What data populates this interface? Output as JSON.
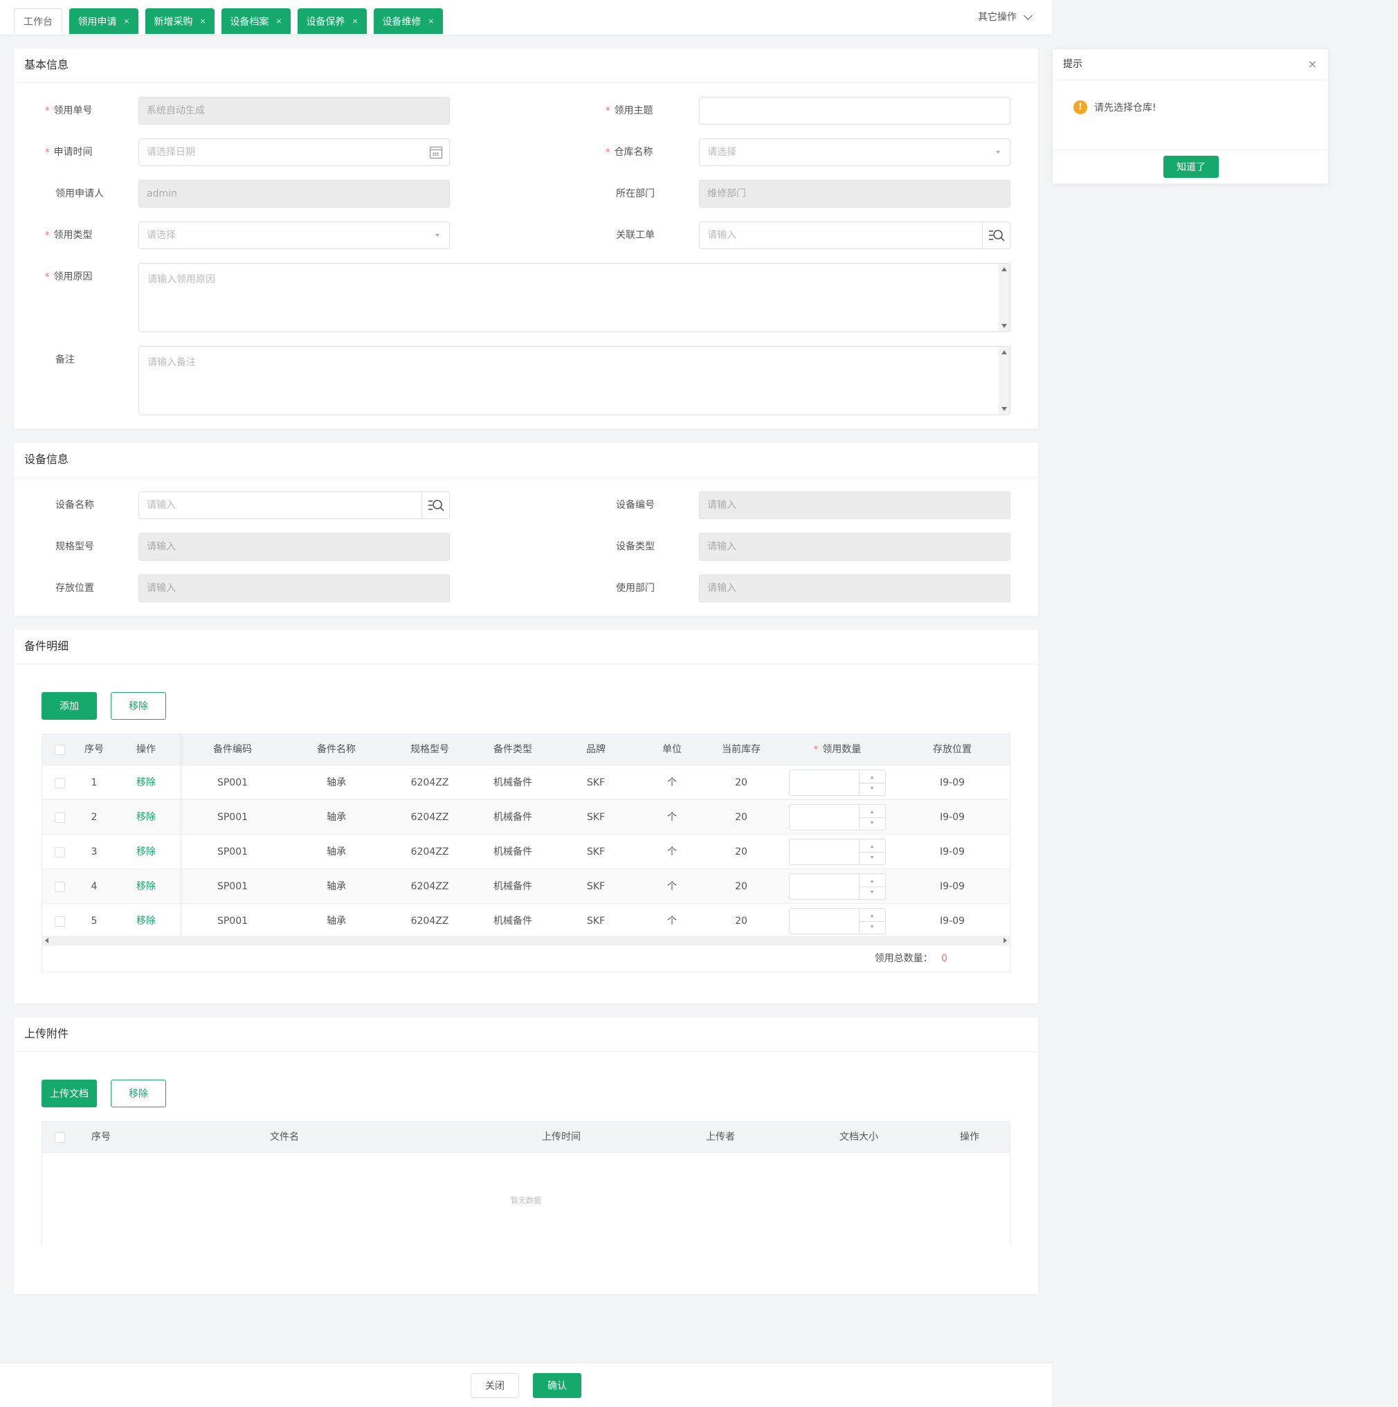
{
  "tabs": {
    "home": "工作台",
    "items": [
      "领用申请",
      "新增采购",
      "设备档案",
      "设备保养",
      "设备维修"
    ],
    "close_glyph": "×",
    "other_ops": "其它操作"
  },
  "basic": {
    "title": "基本信息",
    "req_mark": "*",
    "fields": {
      "order_no": {
        "label": "领用单号",
        "placeholder": "系统自动生成"
      },
      "subject": {
        "label": "领用主题",
        "value": ""
      },
      "apply_time": {
        "label": "申请时间",
        "placeholder": "请选择日期"
      },
      "warehouse": {
        "label": "仓库名称",
        "placeholder": "请选择"
      },
      "applicant": {
        "label": "领用申请人",
        "value": "admin"
      },
      "department": {
        "label": "所在部门",
        "value": "维修部门"
      },
      "type": {
        "label": "领用类型",
        "placeholder": "请选择"
      },
      "work_order": {
        "label": "关联工单",
        "placeholder": "请输入"
      },
      "reason": {
        "label": "领用原因",
        "placeholder": "请输入领用原因"
      },
      "remark": {
        "label": "备注",
        "placeholder": "请输入备注"
      }
    }
  },
  "device": {
    "title": "设备信息",
    "fields": {
      "name": {
        "label": "设备名称",
        "placeholder": "请输入"
      },
      "code": {
        "label": "设备编号",
        "placeholder": "请输入"
      },
      "model": {
        "label": "规格型号",
        "placeholder": "请输入"
      },
      "type": {
        "label": "设备类型",
        "placeholder": "请输入"
      },
      "location": {
        "label": "存放位置",
        "placeholder": "请输入"
      },
      "dept": {
        "label": "使用部门",
        "placeholder": "请输入"
      }
    }
  },
  "parts": {
    "title": "备件明细",
    "add_label": "添加",
    "remove_label": "移除",
    "columns": [
      "序号",
      "操作",
      "备件编码",
      "备件名称",
      "规格型号",
      "备件类型",
      "品牌",
      "单位",
      "当前库存",
      "领用数量",
      "存放位置"
    ],
    "rows": [
      {
        "no": "1",
        "action": "移除",
        "code": "SP001",
        "name": "轴承",
        "model": "6204ZZ",
        "type": "机械备件",
        "brand": "SKF",
        "unit": "个",
        "stock": "20",
        "loc": "I9-09"
      },
      {
        "no": "2",
        "action": "移除",
        "code": "SP001",
        "name": "轴承",
        "model": "6204ZZ",
        "type": "机械备件",
        "brand": "SKF",
        "unit": "个",
        "stock": "20",
        "loc": "I9-09"
      },
      {
        "no": "3",
        "action": "移除",
        "code": "SP001",
        "name": "轴承",
        "model": "6204ZZ",
        "type": "机械备件",
        "brand": "SKF",
        "unit": "个",
        "stock": "20",
        "loc": "I9-09"
      },
      {
        "no": "4",
        "action": "移除",
        "code": "SP001",
        "name": "轴承",
        "model": "6204ZZ",
        "type": "机械备件",
        "brand": "SKF",
        "unit": "个",
        "stock": "20",
        "loc": "I9-09"
      },
      {
        "no": "5",
        "action": "移除",
        "code": "SP001",
        "name": "轴承",
        "model": "6204ZZ",
        "type": "机械备件",
        "brand": "SKF",
        "unit": "个",
        "stock": "20",
        "loc": "I9-09"
      }
    ],
    "total_label": "领用总数量：",
    "total_value": "0"
  },
  "attachments": {
    "title": "上传附件",
    "upload_label": "上传文档",
    "remove_label": "移除",
    "columns": [
      "序号",
      "文件名",
      "上传时间",
      "上传者",
      "文档大小",
      "操作"
    ],
    "empty_text": "暂无数据"
  },
  "dialog": {
    "title": "提示",
    "close_glyph": "×",
    "warn_glyph": "!",
    "message": "请先选择仓库!",
    "ok_label": "知道了"
  },
  "footer": {
    "close_label": "关闭",
    "confirm_label": "确认"
  },
  "colors": {
    "primary": "#15a96b",
    "required": "#f56c6c",
    "warning": "#f5a623"
  }
}
